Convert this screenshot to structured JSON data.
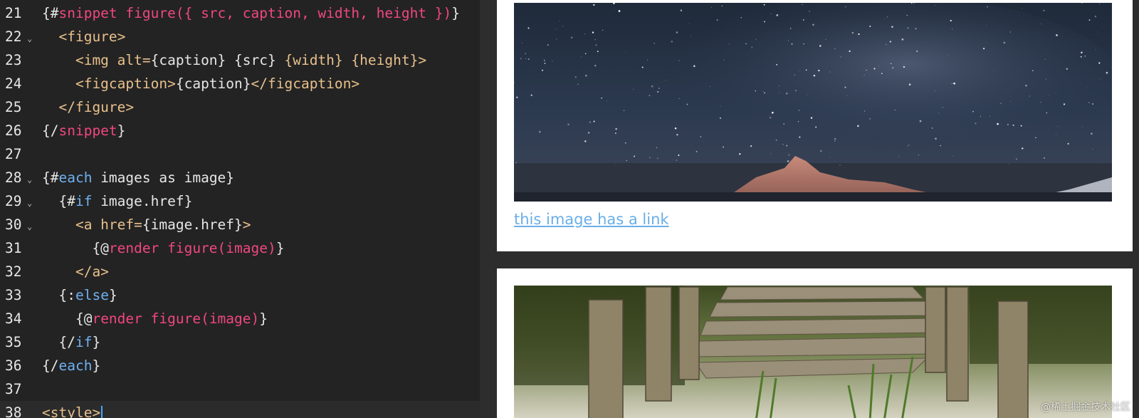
{
  "editor": {
    "lines": [
      {
        "number": "21",
        "fold": "",
        "tokens": [
          {
            "t": "{#",
            "c": "text"
          },
          {
            "t": "snippet figure({ src, caption, width, height })",
            "c": "fn"
          },
          {
            "t": "}",
            "c": "text"
          }
        ]
      },
      {
        "number": "22",
        "fold": "⌄",
        "tokens": [
          {
            "t": "  <figure>",
            "c": "tag"
          }
        ]
      },
      {
        "number": "23",
        "fold": "",
        "tokens": [
          {
            "t": "    <img alt=",
            "c": "tag"
          },
          {
            "t": "{caption} ",
            "c": "text"
          },
          {
            "t": "{src} ",
            "c": "text"
          },
          {
            "t": "{width} ",
            "c": "tag"
          },
          {
            "t": "{height}",
            "c": "tag"
          },
          {
            "t": ">",
            "c": "tag"
          }
        ]
      },
      {
        "number": "24",
        "fold": "",
        "tokens": [
          {
            "t": "    <figcaption>",
            "c": "tag"
          },
          {
            "t": "{caption}",
            "c": "text"
          },
          {
            "t": "</figcaption>",
            "c": "tag"
          }
        ]
      },
      {
        "number": "25",
        "fold": "",
        "tokens": [
          {
            "t": "  </figure>",
            "c": "tag"
          }
        ]
      },
      {
        "number": "26",
        "fold": "",
        "tokens": [
          {
            "t": "{/",
            "c": "text"
          },
          {
            "t": "snippet",
            "c": "fn"
          },
          {
            "t": "}",
            "c": "text"
          }
        ]
      },
      {
        "number": "27",
        "fold": "",
        "tokens": []
      },
      {
        "number": "28",
        "fold": "⌄",
        "tokens": [
          {
            "t": "{#",
            "c": "text"
          },
          {
            "t": "each",
            "c": "kw"
          },
          {
            "t": " images as image}",
            "c": "text"
          }
        ]
      },
      {
        "number": "29",
        "fold": "⌄",
        "tokens": [
          {
            "t": "  {#",
            "c": "text"
          },
          {
            "t": "if",
            "c": "kw"
          },
          {
            "t": " image.href}",
            "c": "text"
          }
        ]
      },
      {
        "number": "30",
        "fold": "⌄",
        "tokens": [
          {
            "t": "    <a href=",
            "c": "tag"
          },
          {
            "t": "{image.href}",
            "c": "text"
          },
          {
            "t": ">",
            "c": "tag"
          }
        ]
      },
      {
        "number": "31",
        "fold": "",
        "tokens": [
          {
            "t": "      {@",
            "c": "text"
          },
          {
            "t": "render figure(image)",
            "c": "fn"
          },
          {
            "t": "}",
            "c": "text"
          }
        ]
      },
      {
        "number": "32",
        "fold": "",
        "tokens": [
          {
            "t": "    </a>",
            "c": "tag"
          }
        ]
      },
      {
        "number": "33",
        "fold": "",
        "tokens": [
          {
            "t": "  {:",
            "c": "text"
          },
          {
            "t": "else",
            "c": "kw"
          },
          {
            "t": "}",
            "c": "text"
          }
        ]
      },
      {
        "number": "34",
        "fold": "",
        "tokens": [
          {
            "t": "    {@",
            "c": "text"
          },
          {
            "t": "render figure(image)",
            "c": "fn"
          },
          {
            "t": "}",
            "c": "text"
          }
        ]
      },
      {
        "number": "35",
        "fold": "",
        "tokens": [
          {
            "t": "  {/",
            "c": "text"
          },
          {
            "t": "if",
            "c": "kw"
          },
          {
            "t": "}",
            "c": "text"
          }
        ]
      },
      {
        "number": "36",
        "fold": "",
        "tokens": [
          {
            "t": "{/",
            "c": "text"
          },
          {
            "t": "each",
            "c": "kw"
          },
          {
            "t": "}",
            "c": "text"
          }
        ]
      },
      {
        "number": "37",
        "fold": "",
        "tokens": []
      },
      {
        "number": "38",
        "fold": "",
        "tokens": [
          {
            "t": "<style>",
            "c": "tag"
          }
        ]
      }
    ]
  },
  "preview": {
    "card1": {
      "image": "starry-sky-mountain-image",
      "link_text": "this image has a link"
    },
    "card2": {
      "image": "wooden-dock-lake-image"
    }
  },
  "watermark": "@稀土掘金技术社区",
  "colors": {
    "fn": "#f0477f",
    "kw": "#6fb1f0",
    "tag": "#e8c08a",
    "link": "#6aaee8"
  }
}
